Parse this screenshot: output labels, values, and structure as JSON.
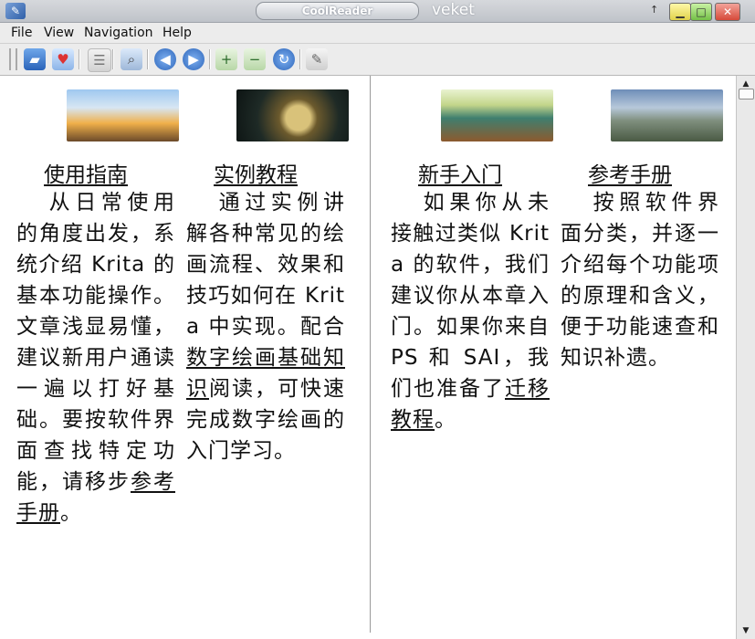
{
  "window": {
    "app_title": "CoolReader",
    "subtitle": "veket",
    "pin_glyph": "↑",
    "minimize_glyph": "▁",
    "maximize_glyph": "□",
    "close_glyph": "✕"
  },
  "menu": {
    "file": "File",
    "view": "View",
    "navigation": "Navigation",
    "help": "Help"
  },
  "toolbar": {
    "open_icon": "open-folder-icon",
    "favorites_icon": "bookmark-heart-icon",
    "toc_icon": "table-of-contents-icon",
    "find_icon": "find-icon",
    "back_icon": "back-arrow-icon",
    "forward_icon": "forward-arrow-icon",
    "zoom_in_icon": "zoom-in-icon",
    "zoom_out_icon": "zoom-out-icon",
    "rotate_icon": "rotate-icon",
    "settings_icon": "settings-wrench-icon"
  },
  "columns": [
    {
      "heading": "使用指南",
      "text": "从日常使用的角度出发，系统介绍 Krita 的基本功能操作。文章浅显易懂，建议新用户通读一遍以打好基础。要按软件界面查找特定功能，请移步",
      "link": "参考手册",
      "tail": "。"
    },
    {
      "heading": "实例教程",
      "text": "通过实例讲解各种常见的绘画流程、效果和技巧如何在 Krita 中实现。配合",
      "link": "数字绘画基础知识",
      "tail": "阅读，可快速完成数字绘画的入门学习。"
    },
    {
      "heading": "新手入门",
      "text": "如果你从未接触过类似 Krita 的软件，我们建议你从本章入门。如果你来自 PS 和 SAI，我们也准备了",
      "link": "迁移教程",
      "tail": "。"
    },
    {
      "heading": "参考手册",
      "text": "按照软件界面分类，并逐一介绍每个功能项的原理和含义，便于功能速查和知识补遗。",
      "link": "",
      "tail": ""
    }
  ],
  "scrollbar": {
    "up_glyph": "▲",
    "down_glyph": "▼"
  }
}
